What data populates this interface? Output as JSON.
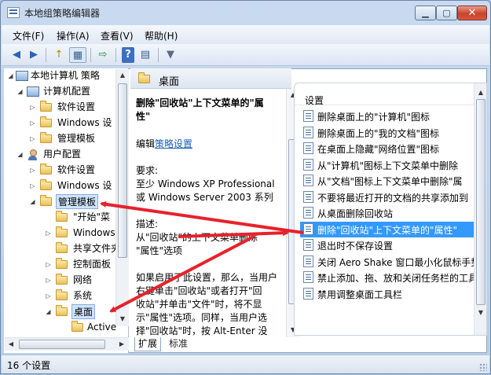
{
  "window": {
    "title": "本地组策略编辑器",
    "minimize": "▁",
    "maximize": "▢",
    "close": "✕"
  },
  "menu": [
    "文件(F)",
    "操作(A)",
    "查看(V)",
    "帮助(H)"
  ],
  "toolbar": {
    "back": "◀",
    "forward": "▶",
    "up": "↑",
    "show_tree": "▦",
    "export": "⇨",
    "help": "?",
    "properties": "▤",
    "filter": "▼"
  },
  "tree": {
    "root": "本地计算机 策略",
    "computer_config": "计算机配置",
    "cc_software": "软件设置",
    "cc_windows": "Windows 设",
    "cc_admin": "管理模板",
    "user_config": "用户配置",
    "uc_software": "软件设置",
    "uc_windows": "Windows 设",
    "uc_admin": "管理模板",
    "start_menu": "\"开始\"菜",
    "windows_comp": "Windows",
    "shared_folders": "共享文件夹",
    "control_panel": "控制面板",
    "network": "网络",
    "system": "系统",
    "desktop": "桌面",
    "active_desktop": "Active"
  },
  "header": {
    "title": "桌面"
  },
  "description": {
    "title_line1": "删除\"回收站\"上下文菜单的\"属",
    "title_line2": "性\"",
    "edit_prefix": "编辑",
    "edit_link": "策略设置",
    "req_label": "要求:",
    "req_line1": "至少 Windows XP Professional",
    "req_line2": "或 Windows Server 2003 系列",
    "desc_label": "描述:",
    "desc_line1": "从\"回收站\"的上下文菜单删除",
    "desc_line2": "\"属性\"选项",
    "body_line1": "如果启用了此设置，那么，当用户",
    "body_line2": "右键单击\"回收站\"或者打开\"回",
    "body_line3": "收站\"并单击\"文件\"时，将不显",
    "body_line4": "示\"属性\"选项。同样，当用户选",
    "body_line5": "择\"回收站\"时，按 Alt-Enter 没"
  },
  "list": {
    "header": "设置",
    "items": [
      "删除桌面上的\"计算机\"图标",
      "删除桌面上的\"我的文档\"图标",
      "在桌面上隐藏\"网络位置\"图标",
      "从\"计算机\"图标上下文菜单中删除",
      "从\"文档\"图标上下文菜单中删除\"属",
      "不要将最近打开的文档的共享添加到",
      "从桌面删除回收站",
      "删除\"回收站\"上下文菜单的\"属性\"",
      "退出时不保存设置",
      "关闭 Aero Shake 窗口最小化鼠标手势",
      "禁止添加、拖、放和关闭任务栏的工具",
      "禁用调整桌面工具栏"
    ]
  },
  "tabs": {
    "extended": "扩展",
    "standard": "标准"
  },
  "status": {
    "text": "16 个设置"
  },
  "colors": {
    "arrow": "#e8212b",
    "selection": "#3399ff"
  },
  "scroll_glyphs": {
    "up": "▲",
    "down": "▼",
    "left": "◀",
    "right": "▶"
  }
}
